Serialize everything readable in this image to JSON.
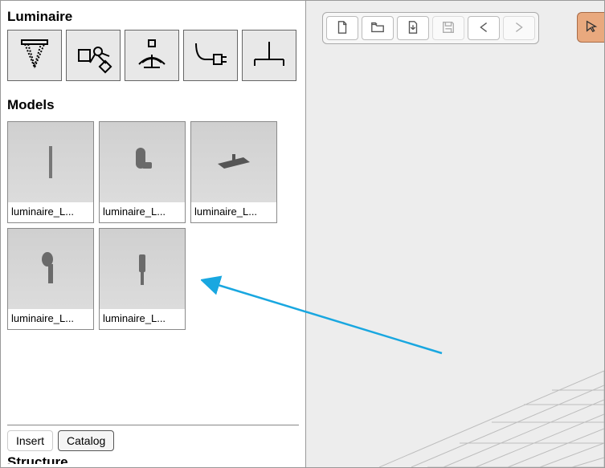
{
  "sections": {
    "luminaire_title": "Luminaire",
    "models_title": "Models",
    "structure_title": "Structure"
  },
  "luminaire_icons": [
    {
      "name": "luminaire-ceiling-spot-icon"
    },
    {
      "name": "luminaire-emitter-icon"
    },
    {
      "name": "luminaire-uplight-icon"
    },
    {
      "name": "luminaire-plug-icon"
    },
    {
      "name": "luminaire-lamp-icon"
    }
  ],
  "models": [
    {
      "label": "luminaire_L...",
      "shape": "rod"
    },
    {
      "label": "luminaire_L...",
      "shape": "cyl-bracket"
    },
    {
      "label": "luminaire_L...",
      "shape": "flat-plate"
    },
    {
      "label": "luminaire_L...",
      "shape": "spotlight"
    },
    {
      "label": "luminaire_L...",
      "shape": "post"
    }
  ],
  "bottom_buttons": {
    "insert": "Insert",
    "catalog": "Catalog"
  },
  "toolbar": [
    {
      "name": "new-file-icon",
      "disabled": false
    },
    {
      "name": "open-file-icon",
      "disabled": false
    },
    {
      "name": "import-icon",
      "disabled": false
    },
    {
      "name": "save-icon",
      "disabled": true
    },
    {
      "name": "back-arrow-icon",
      "disabled": false
    },
    {
      "name": "forward-arrow-icon",
      "disabled": true
    }
  ],
  "cursor_tool": {
    "name": "cursor-tool-icon"
  }
}
